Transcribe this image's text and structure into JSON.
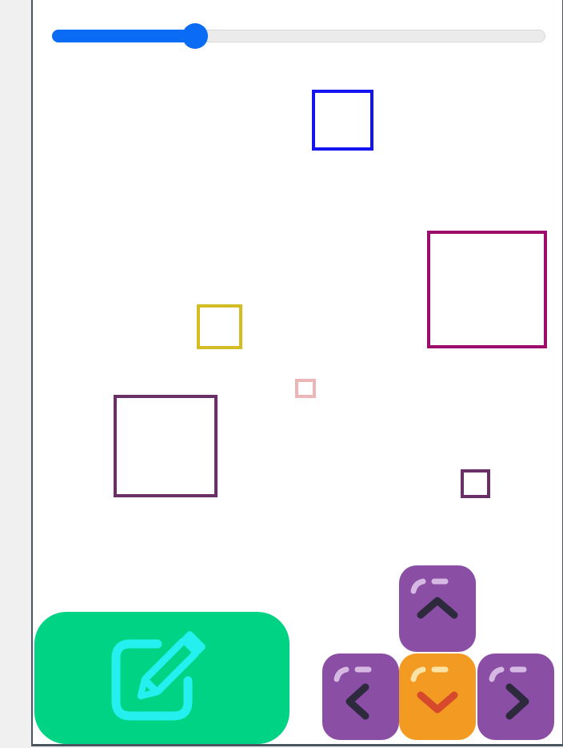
{
  "slider": {
    "value": 0.29
  },
  "squares": [
    {
      "name": "blue-square",
      "color": "#1414f0"
    },
    {
      "name": "magenta-square",
      "color": "#9c0c6a"
    },
    {
      "name": "yellow-square",
      "color": "#d4bd24"
    },
    {
      "name": "pink-square",
      "color": "#ecb6b6"
    },
    {
      "name": "plum-square",
      "color": "#6b2f68"
    },
    {
      "name": "small-plum-square",
      "color": "#6b2f68"
    }
  ],
  "controls": {
    "edit_icon": "pencil-square-icon",
    "edit_button_color": "#00d384",
    "edit_icon_color": "#25f0f0",
    "keys": {
      "up": {
        "icon": "chevron-up-icon",
        "color": "#8a4ea4"
      },
      "left": {
        "icon": "chevron-left-icon",
        "color": "#8a4ea4"
      },
      "down": {
        "icon": "chevron-down-icon",
        "color": "#f29a22"
      },
      "right": {
        "icon": "chevron-right-icon",
        "color": "#8a4ea4"
      }
    }
  }
}
